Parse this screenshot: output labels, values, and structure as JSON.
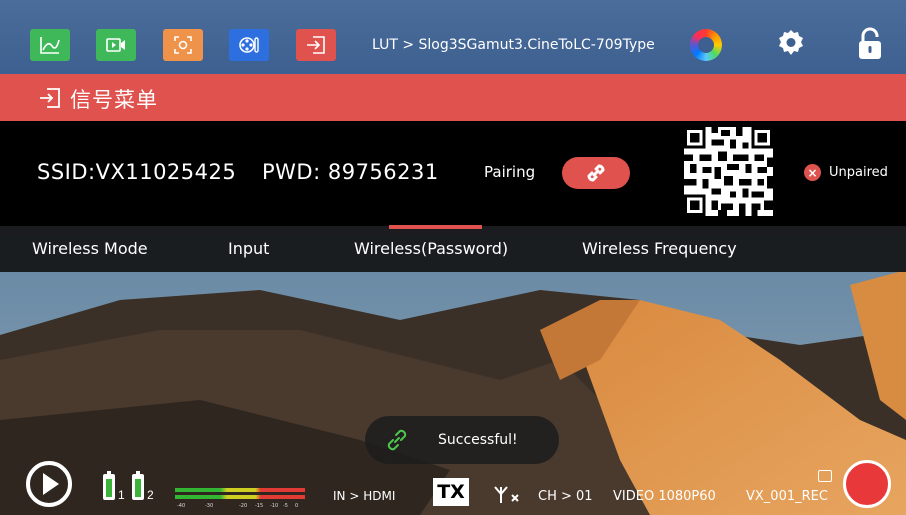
{
  "toolbar": {
    "buttons": [
      {
        "name": "waveform-icon",
        "color": "#3fb85a"
      },
      {
        "name": "video-record-icon",
        "color": "#3fb85a"
      },
      {
        "name": "focus-icon",
        "color": "#f0934a"
      },
      {
        "name": "film-reel-icon",
        "color": "#2e6fe0"
      },
      {
        "name": "input-signal-icon",
        "color": "#e0524e"
      }
    ],
    "lut_label": "LUT > Slog3SGamut3.CineToLC-709Type"
  },
  "header": {
    "title": "信号菜单",
    "color": "#e0524e"
  },
  "wireless": {
    "ssid": "SSID:VX11025425",
    "pwd": "PWD: 89756231",
    "pairing_label": "Pairing",
    "status_label": "Unpaired"
  },
  "tabs": [
    {
      "label": "Wireless Mode"
    },
    {
      "label": "Input"
    },
    {
      "label": "Wireless(Password)"
    },
    {
      "label": "Wireless Frequency"
    }
  ],
  "active_tab": "Wireless(Password)",
  "toast": {
    "message": "Successful!"
  },
  "status": {
    "battery_1": "1",
    "battery_2": "2",
    "input": "IN > HDMI",
    "tx": "TX",
    "channel": "CH > 01",
    "video_format": "VIDEO 1080P60",
    "rec_name": "VX_001_REC",
    "meter_scale": [
      "-40",
      "-30",
      "-20",
      "-15",
      "-10",
      "-5",
      "0"
    ]
  }
}
